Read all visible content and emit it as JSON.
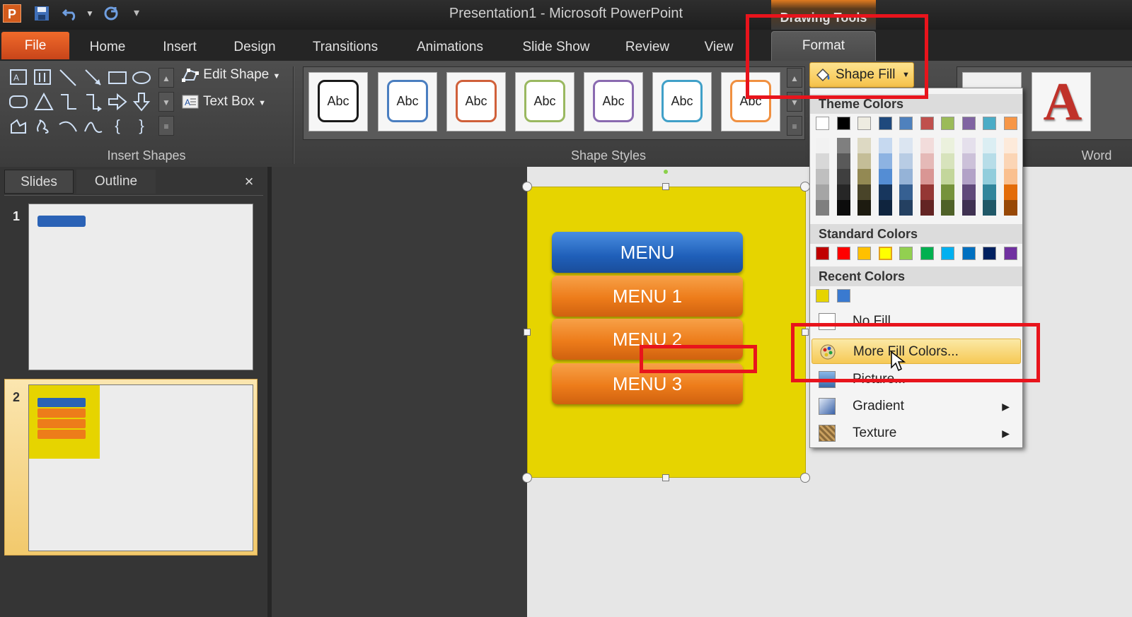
{
  "window": {
    "title": "Presentation1  -  Microsoft PowerPoint",
    "app_icon_letter": "P",
    "contextual_tab_label": "Drawing Tools"
  },
  "quick_access": {
    "save_icon": "save-icon",
    "undo_icon": "undo-icon",
    "redo_icon": "redo-icon",
    "customize_icon": "customize-icon"
  },
  "ribbon_tabs": [
    "File",
    "Home",
    "Insert",
    "Design",
    "Transitions",
    "Animations",
    "Slide Show",
    "Review",
    "View",
    "Format"
  ],
  "insert_shapes": {
    "edit_shape": "Edit Shape",
    "text_box": "Text Box",
    "group_label": "Insert Shapes"
  },
  "shape_styles": {
    "sample_text": "Abc",
    "group_label": "Shape Styles",
    "border_colors": [
      "#1a1a1a",
      "#4a7ec0",
      "#d0603a",
      "#9ab860",
      "#8a6ab0",
      "#40a0c8",
      "#f09040"
    ]
  },
  "shape_fill": {
    "label": "Shape Fill"
  },
  "wordart": {
    "group_label": "Word",
    "glyph": "A"
  },
  "left_pane": {
    "tabs": [
      "Slides",
      "Outline"
    ],
    "close": "×",
    "slides": [
      "1",
      "2"
    ]
  },
  "slide": {
    "menu_items": [
      "MENU",
      "MENU 1",
      "MENU 2",
      "MENU 3"
    ],
    "colors": {
      "background": "#e6d400",
      "menu_primary": "#1f5fb9",
      "menu_secondary": "#ed7c1a"
    }
  },
  "fill_menu": {
    "theme_colors_header": "Theme Colors",
    "standard_colors_header": "Standard Colors",
    "recent_colors_header": "Recent Colors",
    "theme_top_row": [
      "#ffffff",
      "#000000",
      "#eeece1",
      "#1f497d",
      "#4f81bd",
      "#c0504d",
      "#9bbb59",
      "#8064a2",
      "#4bacc6",
      "#f79646"
    ],
    "theme_columns": [
      [
        "#f2f2f2",
        "#d8d8d8",
        "#bfbfbf",
        "#a5a5a5",
        "#7f7f7f"
      ],
      [
        "#7f7f7f",
        "#595959",
        "#3f3f3f",
        "#262626",
        "#0c0c0c"
      ],
      [
        "#ddd9c3",
        "#c4bd97",
        "#938953",
        "#494429",
        "#1d1b10"
      ],
      [
        "#c6d9f0",
        "#8db3e2",
        "#548dd4",
        "#17365d",
        "#0f243e"
      ],
      [
        "#dbe5f1",
        "#b8cce4",
        "#95b3d7",
        "#366092",
        "#244061"
      ],
      [
        "#f2dcdb",
        "#e5b9b7",
        "#d99694",
        "#953734",
        "#632423"
      ],
      [
        "#ebf1dd",
        "#d7e3bc",
        "#c3d69b",
        "#76923c",
        "#4f6128"
      ],
      [
        "#e5e0ec",
        "#ccc1d9",
        "#b2a2c7",
        "#5f497a",
        "#3f3151"
      ],
      [
        "#dbeef3",
        "#b7dde8",
        "#92cddc",
        "#31859b",
        "#205867"
      ],
      [
        "#fdeada",
        "#fbd5b5",
        "#fac08f",
        "#e36c09",
        "#974806"
      ]
    ],
    "standard": [
      "#c00000",
      "#ff0000",
      "#ffc000",
      "#ffff00",
      "#92d050",
      "#00b050",
      "#00b0f0",
      "#0070c0",
      "#002060",
      "#7030a0"
    ],
    "recent": [
      "#e6d400",
      "#3a7ad0"
    ],
    "items": {
      "no_fill": "No Fill",
      "more_fill": "More Fill Colors...",
      "picture": "Picture...",
      "gradient": "Gradient",
      "texture": "Texture"
    },
    "submenu_arrow": "▶"
  }
}
